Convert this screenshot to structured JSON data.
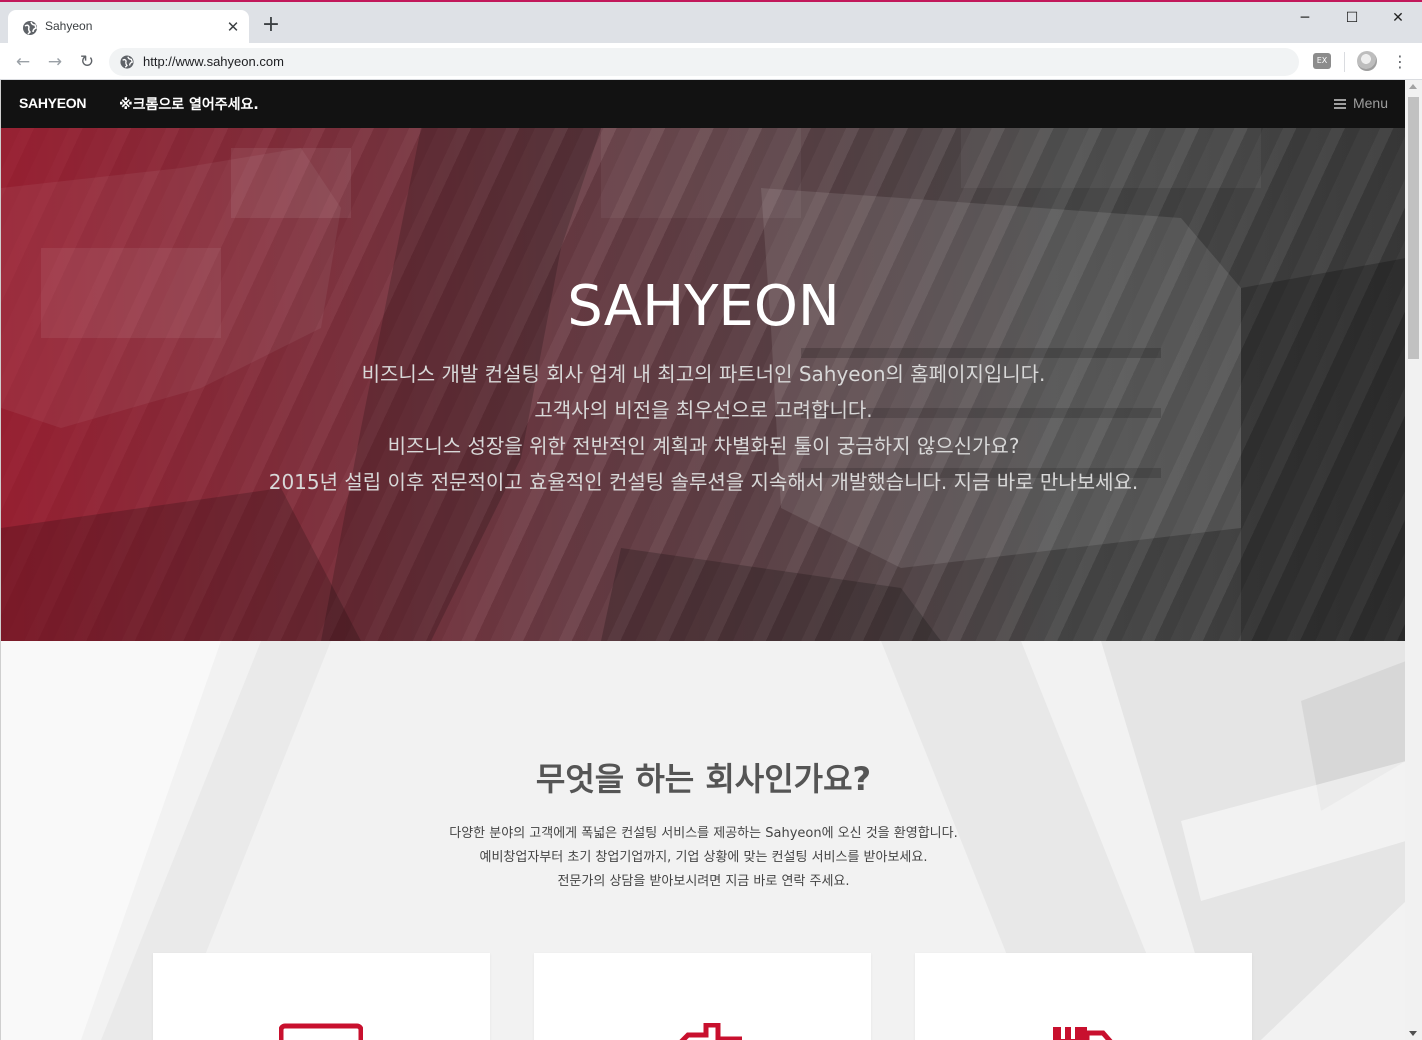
{
  "browser": {
    "tab_title": "Sahyeon",
    "tab_close": "✕",
    "new_tab": "+",
    "url": "http://www.sahyeon.com",
    "win_minimize": "─",
    "win_maximize": "☐",
    "win_close": "✕",
    "back": "←",
    "forward": "→",
    "reload": "↻",
    "menu": "⋮",
    "extension_label": "EX"
  },
  "site": {
    "brand": "SAHYEON",
    "notice": "※크롬으로 열어주세요.",
    "menu_label": "Menu"
  },
  "hero": {
    "title": "SAHYEON",
    "lines": [
      "비즈니스 개발 컨설팅 회사 업계 내 최고의 파트너인 Sahyeon의 홈페이지입니다.",
      "고객사의 비전을 최우선으로 고려합니다.",
      "비즈니스 성장을 위한 전반적인 계획과 차별화된 툴이 궁금하지 않으신가요?",
      "2015년 설립 이후 전문적이고 효율적인 컨설팅 솔루션을 지속해서 개발했습니다. 지금 바로 만나보세요."
    ]
  },
  "about": {
    "title": "무엇을 하는 회사인가요?",
    "lines": [
      "다양한 분야의 고객에게 폭넓은 컨설팅 서비스를 제공하는 Sahyeon에 오신 것을 환영합니다.",
      "예비창업자부터 초기 창업기업까지, 기업 상황에 맞는 컨설팅 서비스를 받아보세요.",
      "전문가의 상담을 받아보시려면 지금 바로 연락 주세요."
    ]
  },
  "cards": [
    {
      "icon": "id-card-icon"
    },
    {
      "icon": "handshake-icon"
    },
    {
      "icon": "truck-icon"
    }
  ],
  "colors": {
    "accent": "#c8102e",
    "nav_bg": "#121212",
    "tab_strip": "#dee1e6"
  }
}
